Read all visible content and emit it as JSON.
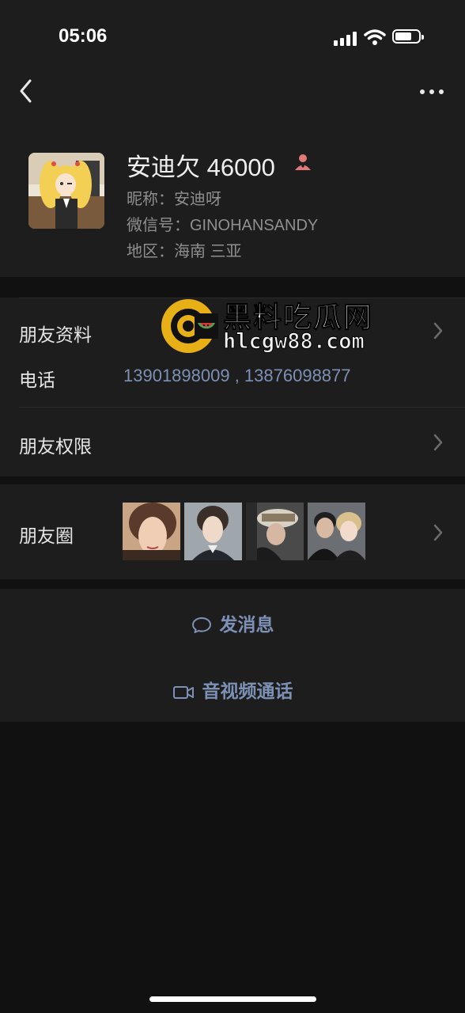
{
  "status_bar": {
    "time": "05:06"
  },
  "profile": {
    "display_name": "安迪欠 46000",
    "nickname": "昵称：安迪呀",
    "wechat_id": "微信号：GINOHANSANDY",
    "region": "地区：海南 三亚"
  },
  "rows": {
    "friend_info_label": "朋友资料",
    "phone_label": "电话",
    "phones": "13901898009 , 13876098877",
    "permissions_label": "朋友权限",
    "moments_label": "朋友圈"
  },
  "actions": {
    "send_message": "发消息",
    "video_call": "音视频通话"
  },
  "watermark": {
    "title": "黑料吃瓜网",
    "url": "hlcgw88.com"
  },
  "colors": {
    "background": "#111111",
    "panel": "#1d1d1d",
    "link_blue": "#7d90b5",
    "star_tag": "#e07a7a",
    "watermark_ring": "#f2b817"
  }
}
